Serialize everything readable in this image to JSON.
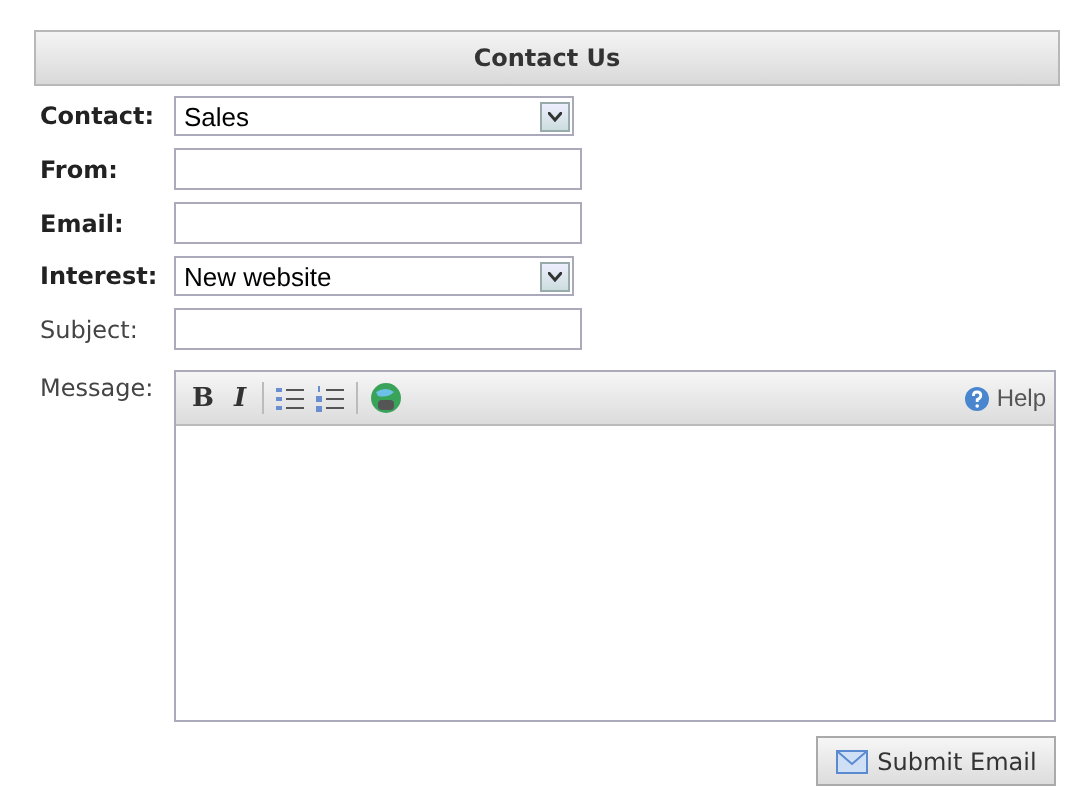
{
  "header": {
    "title": "Contact Us"
  },
  "fields": [
    {
      "label": "Contact:",
      "kind": "select",
      "required": true,
      "value": "Sales"
    },
    {
      "label": "From:",
      "kind": "text",
      "required": true
    },
    {
      "label": "Email:",
      "kind": "text",
      "required": true
    },
    {
      "label": "Interest:",
      "kind": "select",
      "required": true,
      "value": "New website"
    },
    {
      "label": "Subject:",
      "kind": "text",
      "required": false
    }
  ],
  "message": {
    "label": "Message:",
    "required": false,
    "toolbar": {
      "bold": "B",
      "italic": "I",
      "help": "Help"
    }
  },
  "submit": {
    "label": "Submit Email"
  }
}
